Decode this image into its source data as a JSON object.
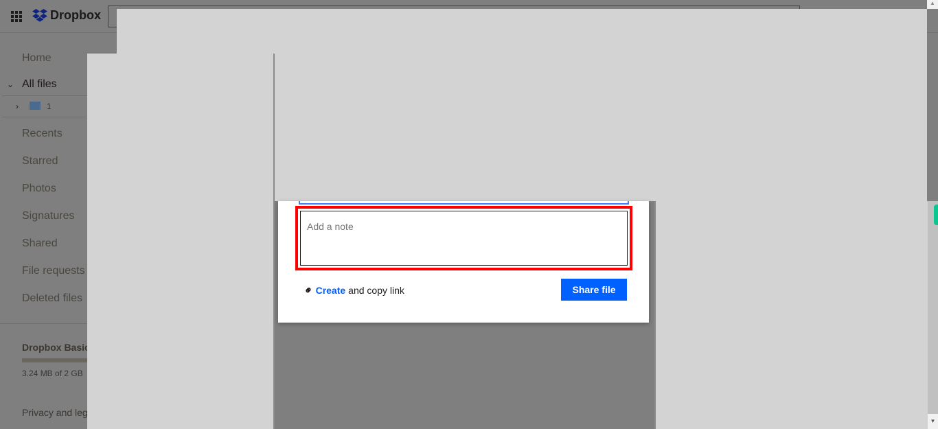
{
  "app": {
    "name": "Dropbox"
  },
  "sidebar": {
    "items": [
      {
        "label": "Home"
      },
      {
        "label": "All files"
      },
      {
        "label": "1"
      },
      {
        "label": "Recents"
      },
      {
        "label": "Starred"
      },
      {
        "label": "Photos"
      },
      {
        "label": "Signatures"
      },
      {
        "label": "Shared"
      },
      {
        "label": "File requests"
      },
      {
        "label": "Deleted files"
      }
    ],
    "plan": {
      "name": "Dropbox Basic",
      "usage": "3.24 MB of 2 GB",
      "used_fraction": 0.0016
    },
    "footer_link": "Privacy and legal"
  },
  "modal": {
    "note_placeholder": "Add a note",
    "create_label": "Create",
    "copy_link_label": "and copy link",
    "share_label": "Share file"
  },
  "colors": {
    "accent": "#0061fe",
    "highlight": "#ff0000"
  }
}
